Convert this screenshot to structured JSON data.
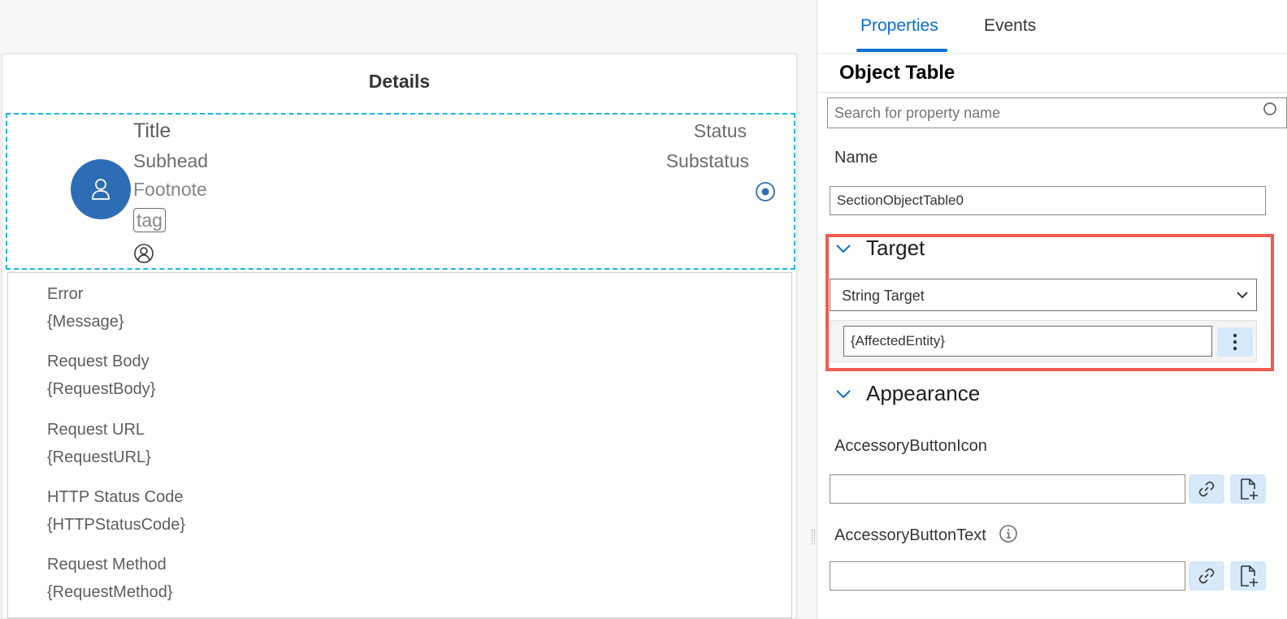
{
  "canvas": {
    "page_title": "Details",
    "object_cell": {
      "title": "Title",
      "subhead": "Subhead",
      "footnote": "Footnote",
      "tag": "tag",
      "status": "Status",
      "substatus": "Substatus",
      "avatar_icon": "person-icon",
      "accent_color": "#2d6db5"
    },
    "key_values": [
      {
        "label": "Error",
        "value": "{Message}"
      },
      {
        "label": "Request Body",
        "value": "{RequestBody}"
      },
      {
        "label": "Request URL",
        "value": "{RequestURL}"
      },
      {
        "label": "HTTP Status Code",
        "value": "{HTTPStatusCode}"
      },
      {
        "label": "Request Method",
        "value": "{RequestMethod}"
      }
    ]
  },
  "panel": {
    "tabs": [
      {
        "label": "Properties",
        "active": true
      },
      {
        "label": "Events",
        "active": false
      }
    ],
    "heading": "Object Table",
    "search": {
      "placeholder": "Search for property name"
    },
    "name": {
      "label": "Name",
      "value": "SectionObjectTable0"
    },
    "target": {
      "title": "Target",
      "select_value": "String Target",
      "input_value": "{AffectedEntity}"
    },
    "appearance": {
      "title": "Appearance",
      "accessory_button_icon": {
        "label": "AccessoryButtonIcon",
        "value": ""
      },
      "accessory_button_text": {
        "label": "AccessoryButtonText",
        "value": ""
      }
    },
    "colors": {
      "accent": "#0a6ed1",
      "highlight": "#ef5b50",
      "selection": "#1fb4e6"
    }
  }
}
